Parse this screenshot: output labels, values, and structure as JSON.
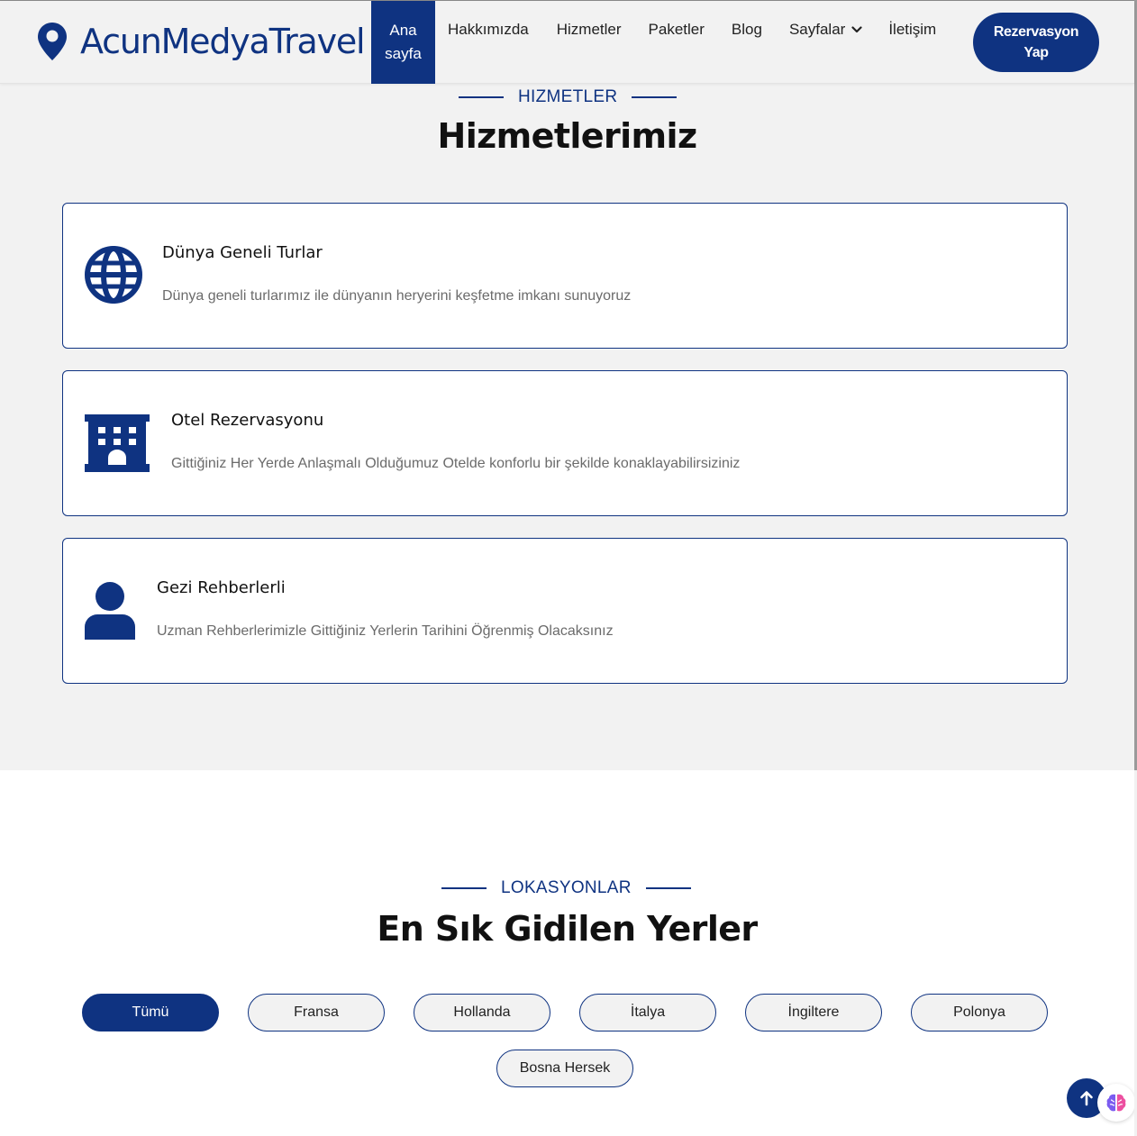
{
  "header": {
    "brand": "AcunMedyaTravel",
    "nav": [
      {
        "label_line1": "Ana",
        "label_line2": "sayfa"
      },
      {
        "label": "Hakkımızda"
      },
      {
        "label": "Hizmetler"
      },
      {
        "label": "Paketler"
      },
      {
        "label": "Blog"
      },
      {
        "label": "Sayfalar"
      },
      {
        "label": "İletişim"
      }
    ],
    "cta_line1": "Rezervasyon",
    "cta_line2": "Yap"
  },
  "services": {
    "eyebrow": "HIZMETLER",
    "title": "Hizmetlerimiz",
    "items": [
      {
        "icon": "globe-icon",
        "title": "Dünya Geneli Turlar",
        "desc": "Dünya geneli turlarımız ile dünyanın heryerini keşfetme imkanı sunuyoruz"
      },
      {
        "icon": "hotel-icon",
        "title": "Otel Rezervasyonu",
        "desc": "Gittiğiniz Her Yerde Anlaşmalı Olduğumuz Otelde konforlu bir şekilde konaklayabilirsiziniz"
      },
      {
        "icon": "user-icon",
        "title": "Gezi Rehberlerli",
        "desc": "Uzman Rehberlerimizle Gittiğiniz Yerlerin Tarihini Öğrenmiş Olacaksınız"
      }
    ]
  },
  "locations": {
    "eyebrow": "LOKASYONLAR",
    "title": "En Sık Gidilen Yerler",
    "filters": [
      "Tümü",
      "Fransa",
      "Hollanda",
      "İtalya",
      "İngiltere",
      "Polonya",
      "Bosna Hersek"
    ],
    "active_filter": "Tümü"
  },
  "colors": {
    "primary": "#0f3381",
    "section_bg": "#f2f2f2",
    "text_muted": "#6b6b6b"
  }
}
